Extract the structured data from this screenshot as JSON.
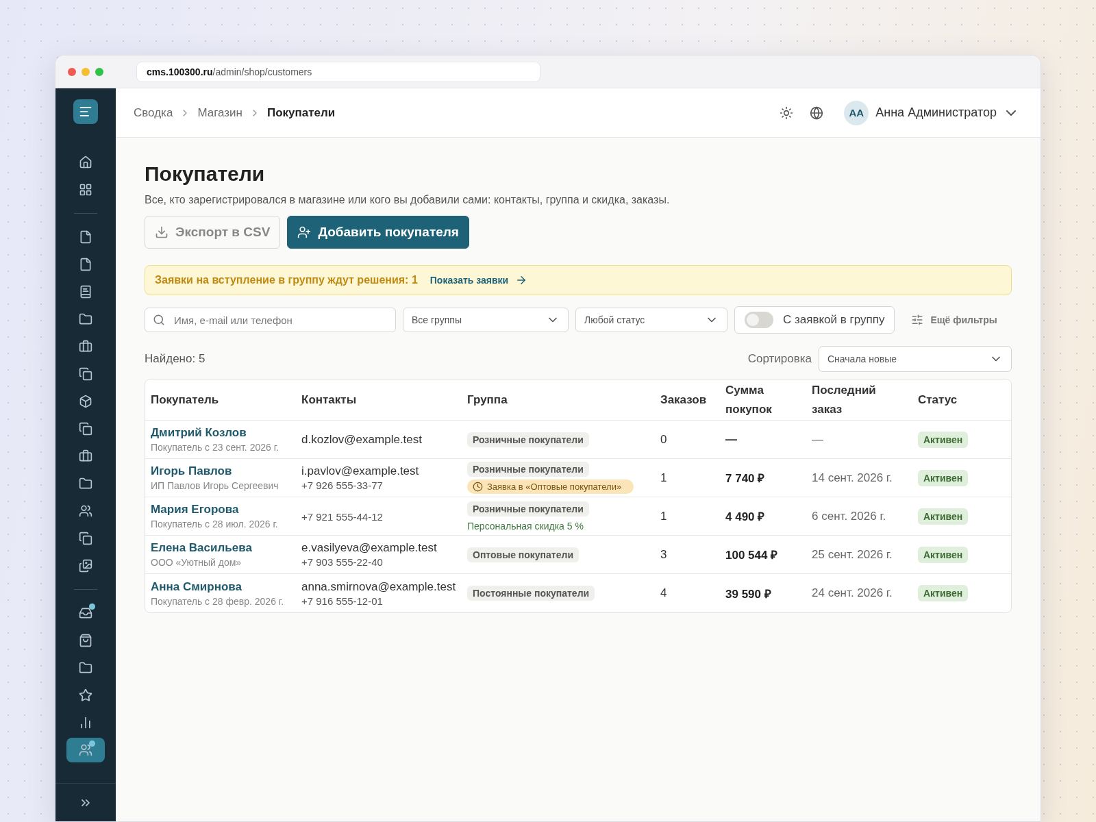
{
  "browser": {
    "url_host": "cms.100300.ru",
    "url_path": "/admin/shop/customers"
  },
  "sidebar": {
    "sections": [
      {
        "items": [
          {
            "selected": false,
            "dot": false
          },
          {
            "selected": false,
            "dot": false
          }
        ]
      },
      {
        "items": [
          {
            "selected": false,
            "dot": false
          },
          {
            "selected": false,
            "dot": false
          },
          {
            "selected": false,
            "dot": false
          },
          {
            "selected": false,
            "dot": false
          },
          {
            "selected": false,
            "dot": false
          },
          {
            "selected": false,
            "dot": false
          },
          {
            "selected": false,
            "dot": false
          },
          {
            "selected": false,
            "dot": false
          },
          {
            "selected": false,
            "dot": false
          },
          {
            "selected": false,
            "dot": false
          },
          {
            "selected": false,
            "dot": false
          },
          {
            "selected": false,
            "dot": false
          },
          {
            "selected": false,
            "dot": false
          }
        ]
      },
      {
        "items": [
          {
            "selected": false,
            "dot": true
          },
          {
            "selected": false,
            "dot": false
          },
          {
            "selected": false,
            "dot": false
          },
          {
            "selected": false,
            "dot": false
          },
          {
            "selected": false,
            "dot": false
          },
          {
            "selected": true,
            "dot": true
          }
        ]
      }
    ]
  },
  "breadcrumbs": [
    {
      "label": "Сводка",
      "current": false
    },
    {
      "label": "Магазин",
      "current": false
    },
    {
      "label": "Покупатели",
      "current": true
    }
  ],
  "user": {
    "initials": "АА",
    "name": "Анна Администратор"
  },
  "page": {
    "title": "Покупатели",
    "description": "Все, кто зарегистрировался в магазине или кого вы добавили сами: контакты, группа и скидка, заказы.",
    "buttons": [
      {
        "kind": "secondary",
        "label": "Экспорт в CSV"
      },
      {
        "kind": "primary",
        "label": "Добавить покупателя"
      }
    ]
  },
  "notice": {
    "text": "Заявки на вступление в группу ждут решения: 1",
    "link": "Показать заявки"
  },
  "filters": {
    "search": {
      "placeholder": "Имя, e-mail или телефон"
    },
    "group": "Все группы",
    "status": "Любой статус",
    "toggle": {
      "label": "С заявкой в группу",
      "on": false
    },
    "more": "Ещё фильтры"
  },
  "found": "Найдено: 5",
  "sort": {
    "label": "Сортировка",
    "value": "Сначала новые"
  },
  "table": {
    "columns": [
      "Покупатель",
      "Контакты",
      "Группа",
      "Заказов",
      "Сумма покупок",
      "Последний заказ",
      "Статус"
    ],
    "rows": [
      {
        "name": "Дмитрий Козлов",
        "sub": "Покупатель с 23 сент. 2026 г.",
        "contacts": [
          {
            "kind": "email",
            "text": "d.kozlov@example.test"
          }
        ],
        "group": [
          {
            "kind": "tag",
            "text": "Розничные покупатели"
          }
        ],
        "orders": "0",
        "total": "—",
        "last_order": "—",
        "status": "Активен"
      },
      {
        "name": "Игорь Павлов",
        "sub": "ИП Павлов Игорь Сергеевич",
        "contacts": [
          {
            "kind": "email",
            "text": "i.pavlov@example.test"
          },
          {
            "kind": "phone",
            "text": "+7 926 555-33-77"
          }
        ],
        "group": [
          {
            "kind": "tag",
            "text": "Розничные покупатели"
          },
          {
            "kind": "request",
            "text": "Заявка в «Оптовые покупатели»"
          }
        ],
        "orders": "1",
        "total": "7 740 ₽",
        "last_order": "14 сент. 2026 г.",
        "status": "Активен"
      },
      {
        "name": "Мария Егорова",
        "sub": "Покупатель с 28 июл. 2026 г.",
        "contacts": [
          {
            "kind": "phone",
            "text": "+7 921 555-44-12"
          }
        ],
        "group": [
          {
            "kind": "tag",
            "text": "Розничные покупатели"
          },
          {
            "kind": "discount",
            "text": "Персональная скидка 5 %"
          }
        ],
        "orders": "1",
        "total": "4 490 ₽",
        "last_order": "6 сент. 2026 г.",
        "status": "Активен"
      },
      {
        "name": "Елена Васильева",
        "sub": "ООО «Уютный дом»",
        "contacts": [
          {
            "kind": "email",
            "text": "e.vasilyeva@example.test"
          },
          {
            "kind": "phone",
            "text": "+7 903 555-22-40"
          }
        ],
        "group": [
          {
            "kind": "tag",
            "text": "Оптовые покупатели"
          }
        ],
        "orders": "3",
        "total": "100 544 ₽",
        "last_order": "25 сент. 2026 г.",
        "status": "Активен"
      },
      {
        "name": "Анна Смирнова",
        "sub": "Покупатель с 28 февр. 2026 г.",
        "contacts": [
          {
            "kind": "email",
            "text": "anna.smirnova@example.test"
          },
          {
            "kind": "phone",
            "text": "+7 916 555-12-01"
          }
        ],
        "group": [
          {
            "kind": "tag",
            "text": "Постоянные покупатели"
          }
        ],
        "orders": "4",
        "total": "39 590 ₽",
        "last_order": "24 сент. 2026 г.",
        "status": "Активен"
      }
    ]
  }
}
